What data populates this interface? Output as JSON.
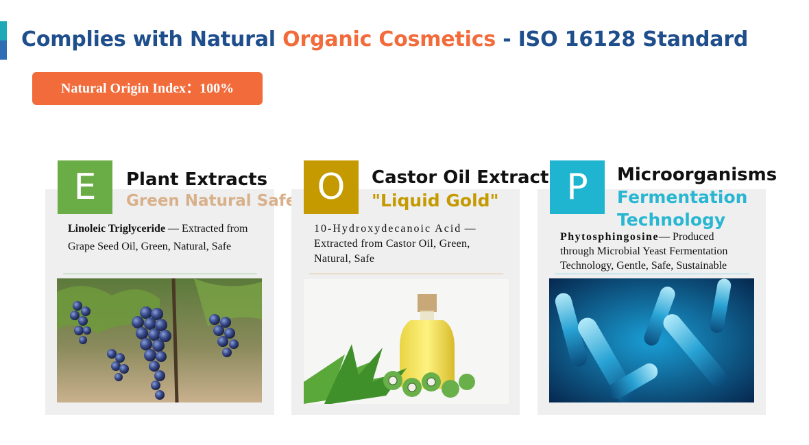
{
  "header": {
    "title_pre": "Complies with Natural ",
    "title_hl": "Organic Cosmetics",
    "title_post": " - ISO 16128 Standard",
    "badge": "Natural Origin Index：100%"
  },
  "colors": {
    "primary": "#1f4e8c",
    "accent": "#f26b3a",
    "green": "#6aac45",
    "gold": "#c49a00",
    "teal": "#1fb5d0"
  },
  "cards": [
    {
      "letter": "E",
      "title": "Plant Extracts",
      "subtitle": "Green Natural Safe",
      "ingredient": "Linoleic Triglyceride",
      "description": " — Extracted from Grape Seed Oil, Green, Natural, Safe",
      "image": "grapes-photo"
    },
    {
      "letter": "O",
      "title": "Castor Oil Extract",
      "subtitle": "\"Liquid Gold\"",
      "ingredient": "10-Hydroxydecanoic Acid",
      "description": " — Extracted from Castor Oil, Green, Natural, Safe",
      "image": "castor-oil-photo"
    },
    {
      "letter": "P",
      "title": "Microorganisms",
      "subtitle_line1": "Fermentation",
      "subtitle_line2": "Technology",
      "ingredient": "Phytosphingosine",
      "description": "— Produced through Microbial Yeast Fermentation Technology, Gentle, Safe, Sustainable",
      "image": "bacteria-photo"
    }
  ]
}
